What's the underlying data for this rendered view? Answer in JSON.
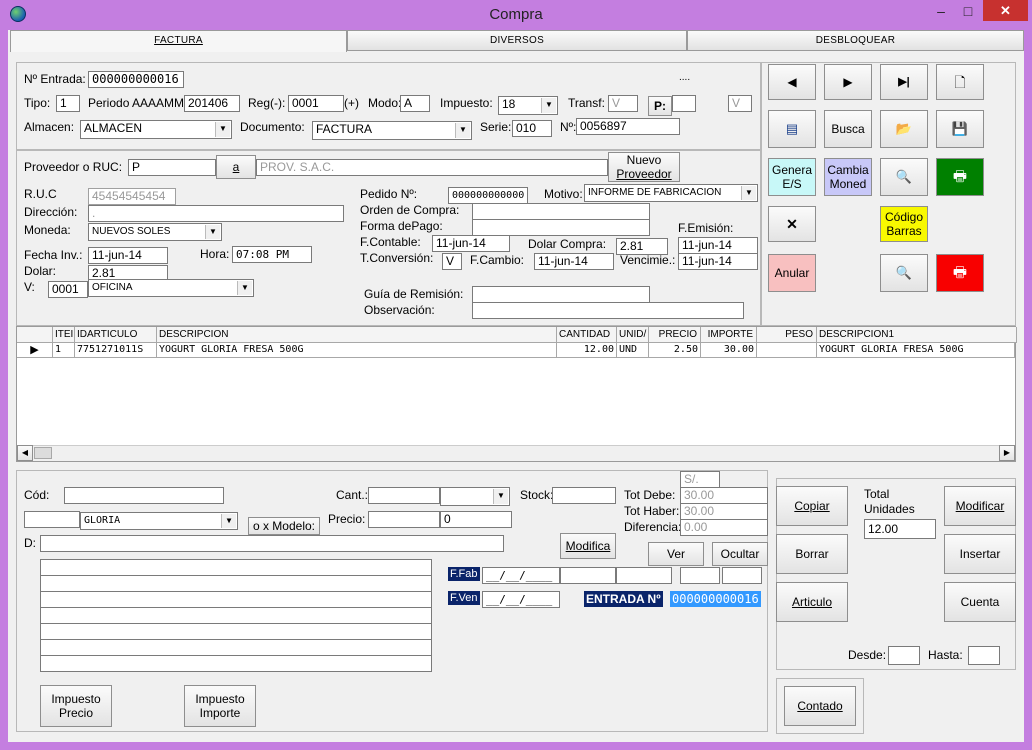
{
  "window": {
    "title": "Compra",
    "minimize": "–",
    "maximize": "□",
    "close": "✕"
  },
  "tabs": [
    {
      "label": "FACTURA"
    },
    {
      "label": "DIVERSOS"
    },
    {
      "label": "DESBLOQUEAR"
    }
  ],
  "header": {
    "nro_entrada_label": "Nº Entrada:",
    "nro_entrada": "000000000016",
    "dots": "....",
    "tipo_label": "Tipo:",
    "tipo": "1",
    "periodo_label": "Periodo AAAAMM:",
    "periodo": "201406",
    "reg_label": "Reg(-):",
    "reg": "0001",
    "reg_plus": "(+)",
    "modo_label": "Modo:",
    "modo": "A",
    "impuesto_label": "Impuesto:",
    "impuesto": "18",
    "transf_label": "Transf:",
    "transf": "V",
    "p_button": "P:",
    "p_value": "",
    "v_value": "V",
    "almacen_label": "Almacen:",
    "almacen": "ALMACEN",
    "documento_label": "Documento:",
    "documento": "FACTURA",
    "serie_label": "Serie:",
    "serie": "010",
    "numero_label": "Nº:",
    "numero": "0056897"
  },
  "proveedor": {
    "label": "Proveedor o RUC:",
    "value": "P",
    "a_button": "a",
    "nombre": "PROV. S.A.C.",
    "nuevo_button_1": "Nuevo",
    "nuevo_button_2": "Proveedor",
    "ruc_label": "R.U.C",
    "ruc": "45454545454",
    "direccion_label": "Dirección:",
    "direccion": ".",
    "moneda_label": "Moneda:",
    "moneda": "NUEVOS SOLES",
    "fecha_label": "Fecha Inv.:",
    "fecha": "11-jun-14",
    "hora_label": "Hora:",
    "hora": "07:08 PM",
    "dolar_label": "Dolar:",
    "dolar": "2.81",
    "v_label": "V:",
    "v_code": "0001",
    "v_name": "OFICINA"
  },
  "pedido": {
    "pedido_label": "Pedido Nº:",
    "pedido": "000000000000",
    "motivo_label": "Motivo:",
    "motivo": "INFORME DE FABRICACION",
    "orden_label": "Orden de Compra:",
    "forma_label": "Forma dePago:",
    "femision_label": "F.Emisión:",
    "fcontable_label": "F.Contable:",
    "fcontable": "11-jun-14",
    "dolarcompra_label": "Dolar Compra:",
    "dolarcompra": "2.81",
    "femision": "11-jun-14",
    "tconv_label": "T.Conversión:",
    "tconv": "V",
    "fcambio_label": "F.Cambio:",
    "fcambio": "11-jun-14",
    "venc_label": "Vencimie.:",
    "venc": "11-jun-14",
    "guia_label": "Guía de Remisión:",
    "obs_label": "Observación:"
  },
  "toolbar": {
    "first_icon": "◀",
    "next_icon": "▶",
    "last_icon": "▶|",
    "new_icon": "🗋",
    "calc_icon": "▤",
    "busca": "Busca",
    "open_icon": "📂",
    "save_icon": "💾",
    "genera_1": "Genera",
    "genera_2": "E/S",
    "cambia_1": "Cambia",
    "cambia_2": "Moned",
    "preview_icon": "🔍",
    "print_icon": "🖶",
    "delete_icon": "✕",
    "codigo_1": "Código",
    "codigo_2": "Barras",
    "anular": "Anular",
    "preview2_icon": "🔍",
    "print2_icon": "🖶",
    "colors": {
      "genera": "#c8f8f8",
      "cambia": "#c8c8f8",
      "print": "#008000",
      "codigo": "#f8f800",
      "anular": "#f8c0c0",
      "print2": "#f80000"
    }
  },
  "grid": {
    "headers": [
      "ITEI",
      "IDARTICULO",
      "DESCRIPCION",
      "CANTIDAD",
      "UNID/",
      "PRECIO",
      "IMPORTE",
      "PESO",
      "DESCRIPCION1"
    ],
    "rows": [
      {
        "item": "1",
        "id": "7751271011S",
        "desc": "YOGURT GLORIA FRESA 500G",
        "cant": "12.00",
        "unid": "UND",
        "precio": "2.50",
        "importe": "30.00",
        "peso": "",
        "desc1": "YOGURT GLORIA FRESA 500G"
      }
    ],
    "scroll_left": "◀",
    "scroll_right": "▶",
    "row_pointer": "▶"
  },
  "detail": {
    "cod_label": "Cód:",
    "marca": "GLORIA",
    "modelo_button": "o x Modelo:",
    "d_label": "D:",
    "cant_label": "Cant.:",
    "stock_label": "Stock:",
    "precio_label": "Precio:",
    "precio2": "0",
    "modifica_button": "Modifica",
    "moneda_simbolo": "S/.",
    "totdebe_label": "Tot Debe:",
    "totdebe": "30.00",
    "tothaber_label": "Tot Haber:",
    "tothaber": "30.00",
    "dif_label": "Diferencia:",
    "dif": "0.00",
    "ver_button": "Ver",
    "ocultar_button": "Ocultar",
    "ffab_label": "F.Fab",
    "ffab": "__/__/____",
    "fven_label": "F.Ven",
    "fven": "__/__/____",
    "entrada_label": "ENTRADA Nº",
    "entrada": "000000000016",
    "imp_precio_1": "Impuesto",
    "imp_precio_2": "Precio",
    "imp_importe_1": "Impuesto",
    "imp_importe_2": "Importe"
  },
  "side": {
    "copiar": "Copiar",
    "borrar": "Borrar",
    "articulo": "Articulo",
    "total_label_1": "Total",
    "total_label_2": "Unidades",
    "total": "12.00",
    "modificar": "Modificar",
    "insertar": "Insertar",
    "cuenta": "Cuenta",
    "desde_label": "Desde:",
    "hasta_label": "Hasta:",
    "contado": "Contado"
  }
}
